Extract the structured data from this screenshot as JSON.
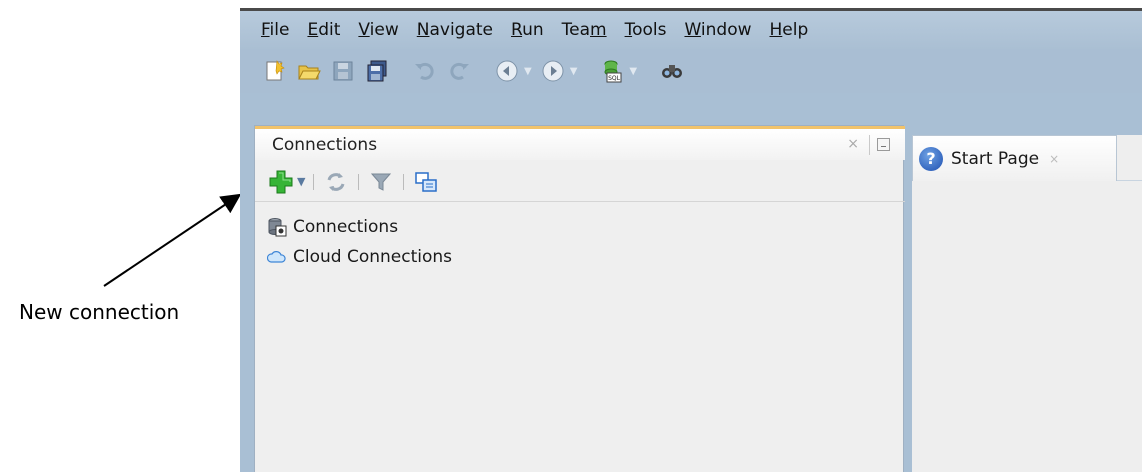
{
  "annotation": {
    "label": "New connection"
  },
  "menubar": {
    "items": [
      {
        "prefix": "",
        "mnemonic": "F",
        "suffix": "ile"
      },
      {
        "prefix": "",
        "mnemonic": "E",
        "suffix": "dit"
      },
      {
        "prefix": "",
        "mnemonic": "V",
        "suffix": "iew"
      },
      {
        "prefix": "",
        "mnemonic": "N",
        "suffix": "avigate"
      },
      {
        "prefix": "",
        "mnemonic": "R",
        "suffix": "un"
      },
      {
        "prefix": "Tea",
        "mnemonic": "m",
        "suffix": ""
      },
      {
        "prefix": "",
        "mnemonic": "T",
        "suffix": "ools"
      },
      {
        "prefix": "",
        "mnemonic": "W",
        "suffix": "indow"
      },
      {
        "prefix": "",
        "mnemonic": "H",
        "suffix": "elp"
      }
    ]
  },
  "toolbar": {
    "icons": [
      "new-file-icon",
      "open-folder-icon",
      "save-icon",
      "save-all-icon",
      "undo-icon",
      "redo-icon",
      "back-icon",
      "forward-icon",
      "sql-worksheet-icon",
      "binoculars-icon"
    ]
  },
  "connections_panel": {
    "title": "Connections",
    "close_glyph": "×",
    "tree": [
      {
        "label": "Connections",
        "icon": "database-icon"
      },
      {
        "label": "Cloud Connections",
        "icon": "cloud-icon"
      }
    ]
  },
  "editor": {
    "tab_label": "Start Page",
    "tab_icon_glyph": "?",
    "tab_close_glyph": "×"
  },
  "colors": {
    "menubar_bg": "#b7cadc",
    "panel_accent": "#f2c36b",
    "add_green": "#2fa32f",
    "highlight_red": "#e0292b"
  }
}
